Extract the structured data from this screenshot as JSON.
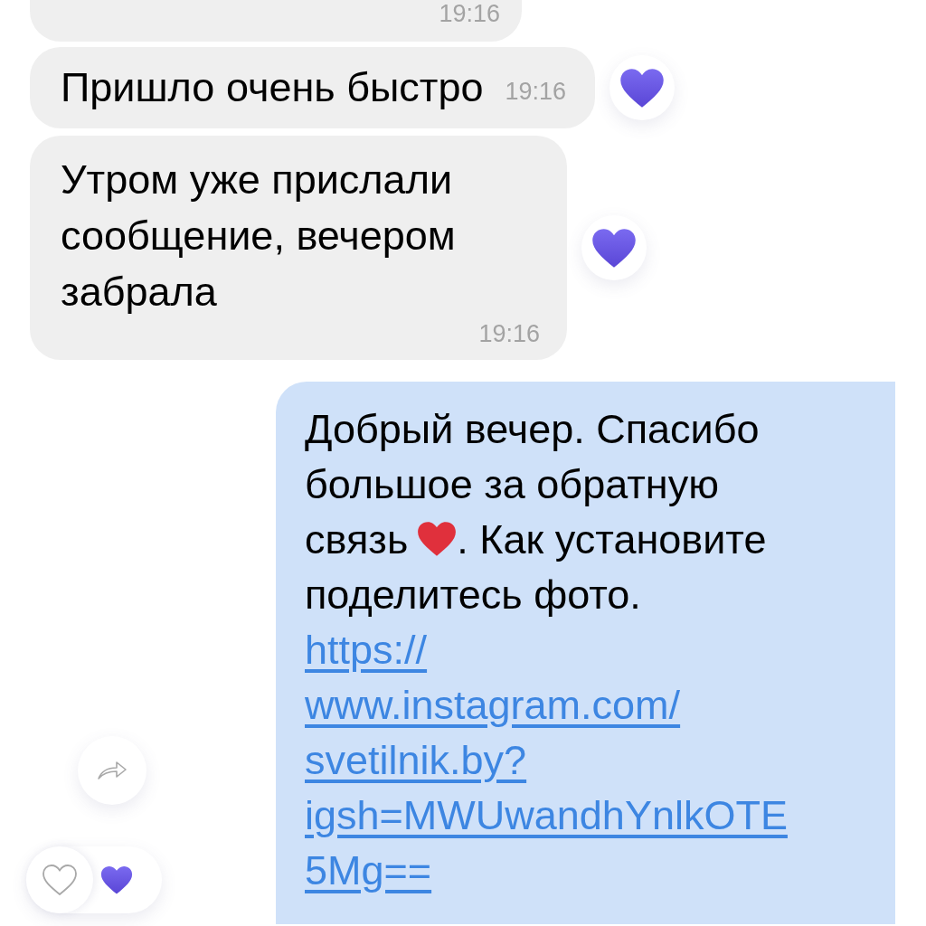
{
  "messages": [
    {
      "kind": "incoming_tail",
      "time": "19:16"
    },
    {
      "kind": "incoming",
      "text": "Пришло очень быстро",
      "time": "19:16",
      "time_inline": true,
      "liked": true
    },
    {
      "kind": "incoming",
      "text": "Утром уже прислали сообщение, вечером забрала",
      "time": "19:16",
      "time_inline": false,
      "liked": true
    },
    {
      "kind": "outgoing",
      "parts": [
        {
          "kind": "text",
          "text": "Добрый вечер. Спасибо"
        },
        {
          "kind": "line_break"
        },
        {
          "kind": "text",
          "text": "большое за обратную"
        },
        {
          "kind": "line_break"
        },
        {
          "kind": "text",
          "text": "связь"
        },
        {
          "kind": "heart_emoji"
        },
        {
          "kind": "text",
          "text": ". Как установите"
        },
        {
          "kind": "line_break"
        },
        {
          "kind": "text",
          "text": "поделитесь фото."
        },
        {
          "kind": "link",
          "lines": [
            "https://",
            "www.instagram.com/",
            "svetilnik.by?",
            "igsh=MWUwandhYnlkOTE",
            "5Mg=="
          ]
        }
      ],
      "liked": true
    }
  ]
}
